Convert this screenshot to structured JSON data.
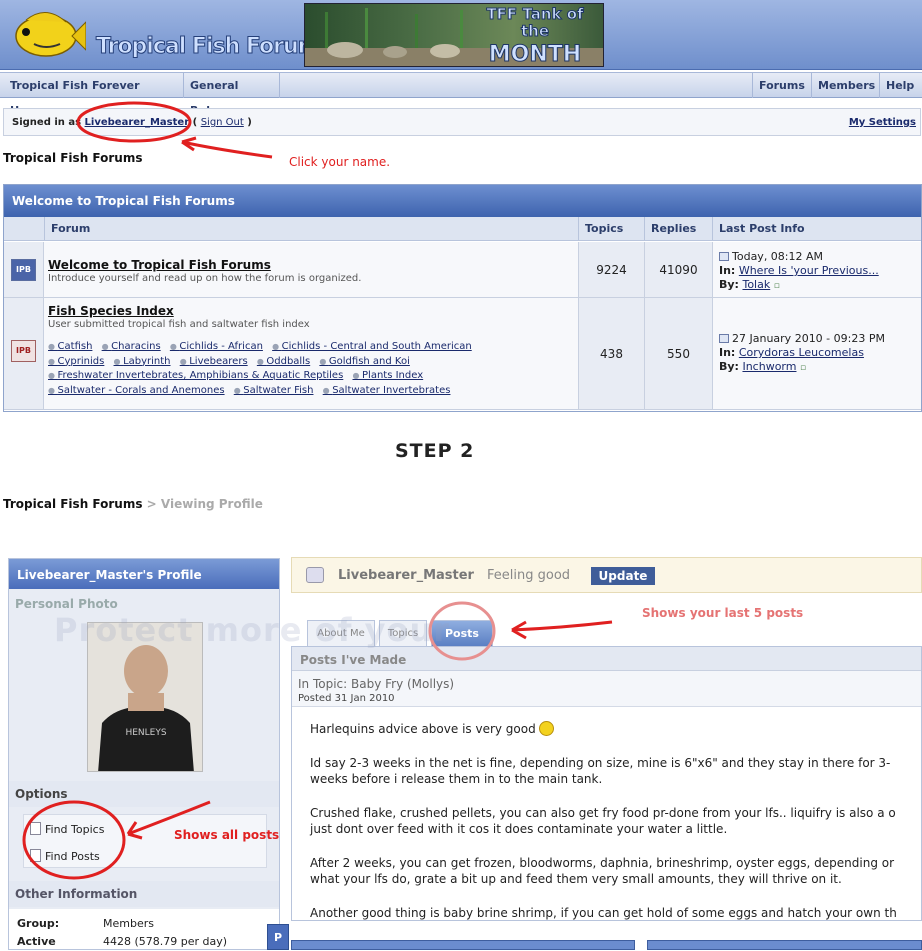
{
  "banner": {
    "site_logo_text": "Tropical Fish Forums",
    "tank_banner_title": "TFF Tank of the",
    "tank_banner_subtitle": "MONTH"
  },
  "nav": {
    "left_items": [
      "Tropical Fish Forever Home",
      "General Rules"
    ],
    "right_items": [
      "Forums",
      "Members",
      "Help"
    ]
  },
  "userbar": {
    "signed_in_prefix": "Signed in as",
    "username": "Livebearer_Master",
    "sign_out": "Sign Out",
    "my_settings": "My Settings"
  },
  "breadcrumb_step1": "Tropical Fish Forums",
  "forum_table": {
    "category": "Welcome to Tropical Fish Forums",
    "columns": [
      "Forum",
      "Topics",
      "Replies",
      "Last Post Info"
    ],
    "rows": [
      {
        "icon": "IPB",
        "title": "Welcome to Tropical Fish Forums",
        "description": "Introduce yourself and read up on how the forum is organized.",
        "topics": "9224",
        "replies": "41090",
        "last_date": "Today, 08:12 AM",
        "last_in_label": "In:",
        "last_in": "Where Is 'your Previous...",
        "last_by_label": "By:",
        "last_by": "Tolak"
      },
      {
        "icon": "IPB",
        "title": "Fish Species Index",
        "description": "User submitted tropical fish and saltwater fish index",
        "topics": "438",
        "replies": "550",
        "last_date": "27 January 2010 - 09:23 PM",
        "last_in_label": "In:",
        "last_in": "Corydoras Leucomelas",
        "last_by_label": "By:",
        "last_by": "Inchworm",
        "subforums": [
          [
            "Catfish",
            "Characins",
            "Cichlids - African",
            "Cichlids - Central and South American"
          ],
          [
            "Cyprinids",
            "Labyrinth",
            "Livebearers",
            "Oddballs",
            "Goldfish and Koi"
          ],
          [
            "Freshwater Invertebrates, Amphibians & Aquatic Reptiles",
            "Plants Index"
          ],
          [
            "Saltwater - Corals and Anemones",
            "Saltwater Fish",
            "Saltwater Invertebrates"
          ]
        ]
      }
    ]
  },
  "step2_heading": "STEP 2",
  "breadcrumb_step2": {
    "root": "Tropical Fish Forums",
    "separator": ">",
    "current": "Viewing Profile"
  },
  "profile": {
    "header": "Livebearer_Master's Profile",
    "photo_label": "Personal Photo",
    "options_label": "Options",
    "options": [
      "Find Topics",
      "Find Posts"
    ],
    "other_info_label": "Other Information",
    "info": [
      {
        "label": "Group:",
        "value": "Members"
      },
      {
        "label": "Active",
        "value": "4428 (578.79 per day)"
      }
    ],
    "side_stub": "P"
  },
  "status": {
    "name": "Livebearer_Master",
    "text": "Feeling good",
    "update_button": "Update"
  },
  "tabs": [
    "About Me",
    "Topics",
    "Posts"
  ],
  "posts_panel": {
    "header": "Posts I've Made",
    "topic_line": "In Topic: Baby Fry (Mollys)",
    "posted": "Posted 31 Jan 2010",
    "paragraphs": [
      "Harlequins advice above is very good",
      "Id say 2-3 weeks in the net is fine, depending on size, mine is 6\"x6\" and they stay in there for 3-",
      "weeks before i release them in to the main tank.",
      "Crushed flake, crushed pellets, you can also get fry food pr-done from your lfs.. liquifry is also a o",
      "just dont over feed with it cos it does contaminate your water a little.",
      "After 2 weeks, you can get frozen, bloodworms, daphnia, brineshrimp, oyster eggs, depending or",
      "what your lfs do, grate a bit up and feed them very small amounts, they will thrive on it.",
      "Another good thing is baby brine shrimp, if you can get hold of some eggs and hatch your own th"
    ]
  },
  "watermark": "Protect more of your",
  "annotations": {
    "click_name": "Click your name.",
    "last_posts": "Shows your last 5 posts",
    "all_posts": "Shows all posts",
    "color": "#e02020"
  }
}
